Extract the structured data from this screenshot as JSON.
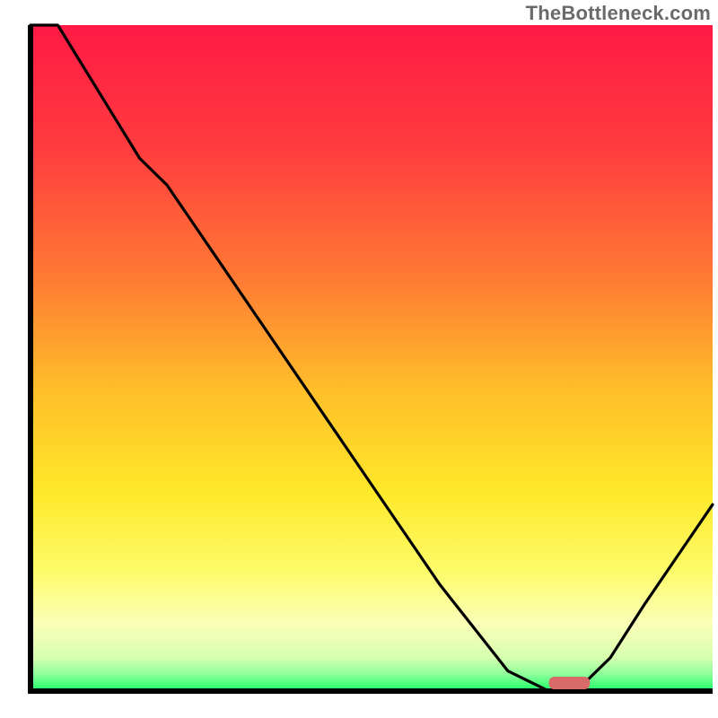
{
  "watermark": "TheBottleneck.com",
  "chart_data": {
    "type": "line",
    "title": "",
    "xlabel": "",
    "ylabel": "",
    "xlim": [
      0,
      100
    ],
    "ylim": [
      0,
      100
    ],
    "grid": false,
    "legend": false,
    "note": "No axis ticks or numeric labels visible. X and Y read as 0–100 percent of plot area. Curve depicts a bottleneck-shaped valley over a red→yellow→green vertical gradient.",
    "series": [
      {
        "name": "curve",
        "x": [
          0,
          4,
          16,
          20,
          30,
          40,
          50,
          60,
          70,
          76,
          80,
          85,
          90,
          100
        ],
        "y": [
          100,
          100,
          80,
          76,
          61,
          46,
          31,
          16,
          3,
          0,
          0,
          5,
          13,
          28
        ]
      }
    ],
    "marker": {
      "name": "optimal-range",
      "x_start": 76,
      "x_end": 82,
      "y": 0,
      "color": "#d86a6a"
    },
    "gradient_stops": [
      {
        "offset": 0.0,
        "color": "#ff1a45"
      },
      {
        "offset": 0.18,
        "color": "#ff3b3f"
      },
      {
        "offset": 0.38,
        "color": "#ff7a34"
      },
      {
        "offset": 0.55,
        "color": "#ffbf2a"
      },
      {
        "offset": 0.7,
        "color": "#ffe829"
      },
      {
        "offset": 0.82,
        "color": "#fdfc6a"
      },
      {
        "offset": 0.9,
        "color": "#faffb8"
      },
      {
        "offset": 0.95,
        "color": "#d6ffb0"
      },
      {
        "offset": 0.975,
        "color": "#8CFF9A"
      },
      {
        "offset": 1.0,
        "color": "#1AFF66"
      }
    ]
  }
}
